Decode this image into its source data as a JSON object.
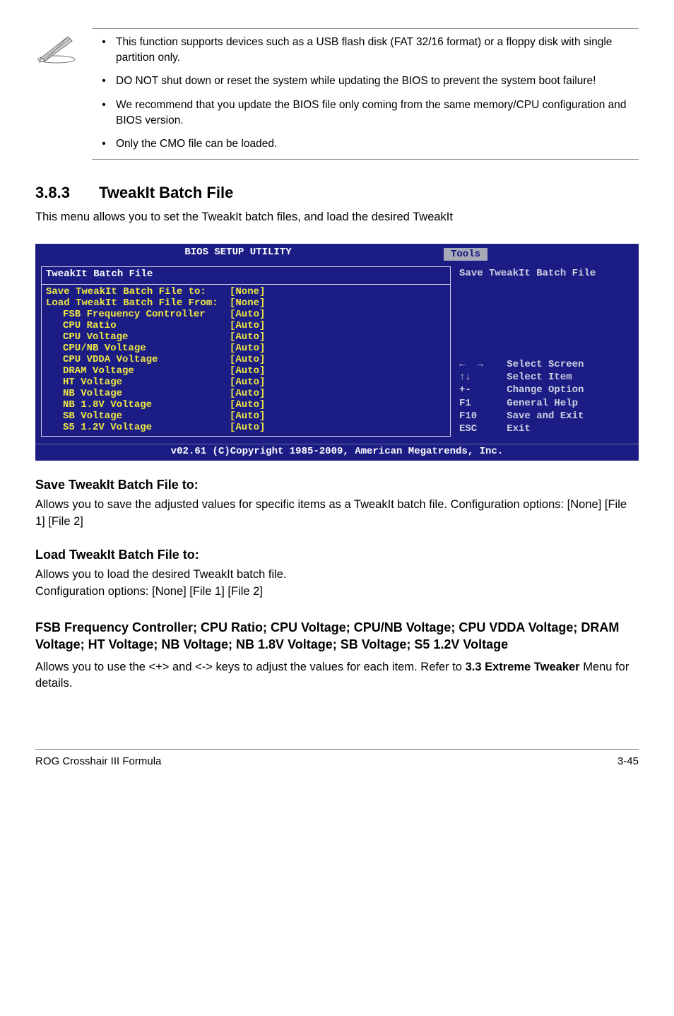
{
  "notes": [
    "This function supports devices such as a USB flash disk (FAT 32/16 format) or a floppy disk with single partition only.",
    "DO NOT shut down or reset the system while updating the BIOS to prevent the system boot failure!",
    "We recommend that you update the BIOS file only coming from the same memory/CPU configuration and BIOS version.",
    "Only the CMO file can be loaded."
  ],
  "section": {
    "num": "3.8.3",
    "name": "TweakIt Batch File",
    "intro": "This menu allows you to set the TweakIt batch files, and load the desired TweakIt"
  },
  "bios": {
    "title": "BIOS SETUP UTILITY",
    "tab": "Tools",
    "panel_title": "TweakIt Batch File",
    "rows": [
      {
        "indent": false,
        "label": "Save TweakIt Batch File to:",
        "value": "[None]"
      },
      {
        "indent": false,
        "label": "Load TweakIt Batch File From:",
        "value": "[None]"
      },
      {
        "indent": true,
        "label": "FSB Frequency Controller",
        "value": "[Auto]"
      },
      {
        "indent": true,
        "label": "CPU Ratio",
        "value": "[Auto]"
      },
      {
        "indent": true,
        "label": "CPU Voltage",
        "value": "[Auto]"
      },
      {
        "indent": true,
        "label": "CPU/NB Voltage",
        "value": "[Auto]"
      },
      {
        "indent": true,
        "label": "CPU VDDA Voltage",
        "value": "[Auto]"
      },
      {
        "indent": true,
        "label": "DRAM Voltage",
        "value": "[Auto]"
      },
      {
        "indent": true,
        "label": "HT Voltage",
        "value": "[Auto]"
      },
      {
        "indent": true,
        "label": "NB Voltage",
        "value": "[Auto]"
      },
      {
        "indent": true,
        "label": "NB 1.8V Voltage",
        "value": "[Auto]"
      },
      {
        "indent": true,
        "label": "SB Voltage",
        "value": "[Auto]"
      },
      {
        "indent": true,
        "label": "S5 1.2V Voltage",
        "value": "[Auto]"
      }
    ],
    "help": "Save TweakIt Batch File",
    "keys": "←  →    Select Screen\n↑↓      Select Item\n+-      Change Option\nF1      General Help\nF10     Save and Exit\nESC     Exit",
    "footer": "v02.61 (C)Copyright 1985-2009, American Megatrends, Inc."
  },
  "sub1": {
    "title": "Save TweakIt Batch File to:",
    "body": "Allows you to save the adjusted values for specific items as a TweakIt batch file. Configuration options: [None] [File 1] [File 2]"
  },
  "sub2": {
    "title": "Load TweakIt Batch File to:",
    "body1": "Allows you to load the desired TweakIt batch file.",
    "body2": "Configuration options: [None] [File 1] [File 2]"
  },
  "sub3": {
    "title": "FSB Frequency Controller; CPU Ratio; CPU Voltage; CPU/NB Voltage; CPU VDDA Voltage; DRAM Voltage; HT Voltage; NB Voltage; NB 1.8V Voltage; SB Voltage; S5 1.2V Voltage",
    "body_pre": "Allows you to use the <+> and <-> keys to adjust the values for each item. Refer to ",
    "body_bold": "3.3 Extreme Tweaker",
    "body_post": " Menu for details."
  },
  "footer": {
    "left": "ROG Crosshair III Formula",
    "right": "3-45"
  }
}
